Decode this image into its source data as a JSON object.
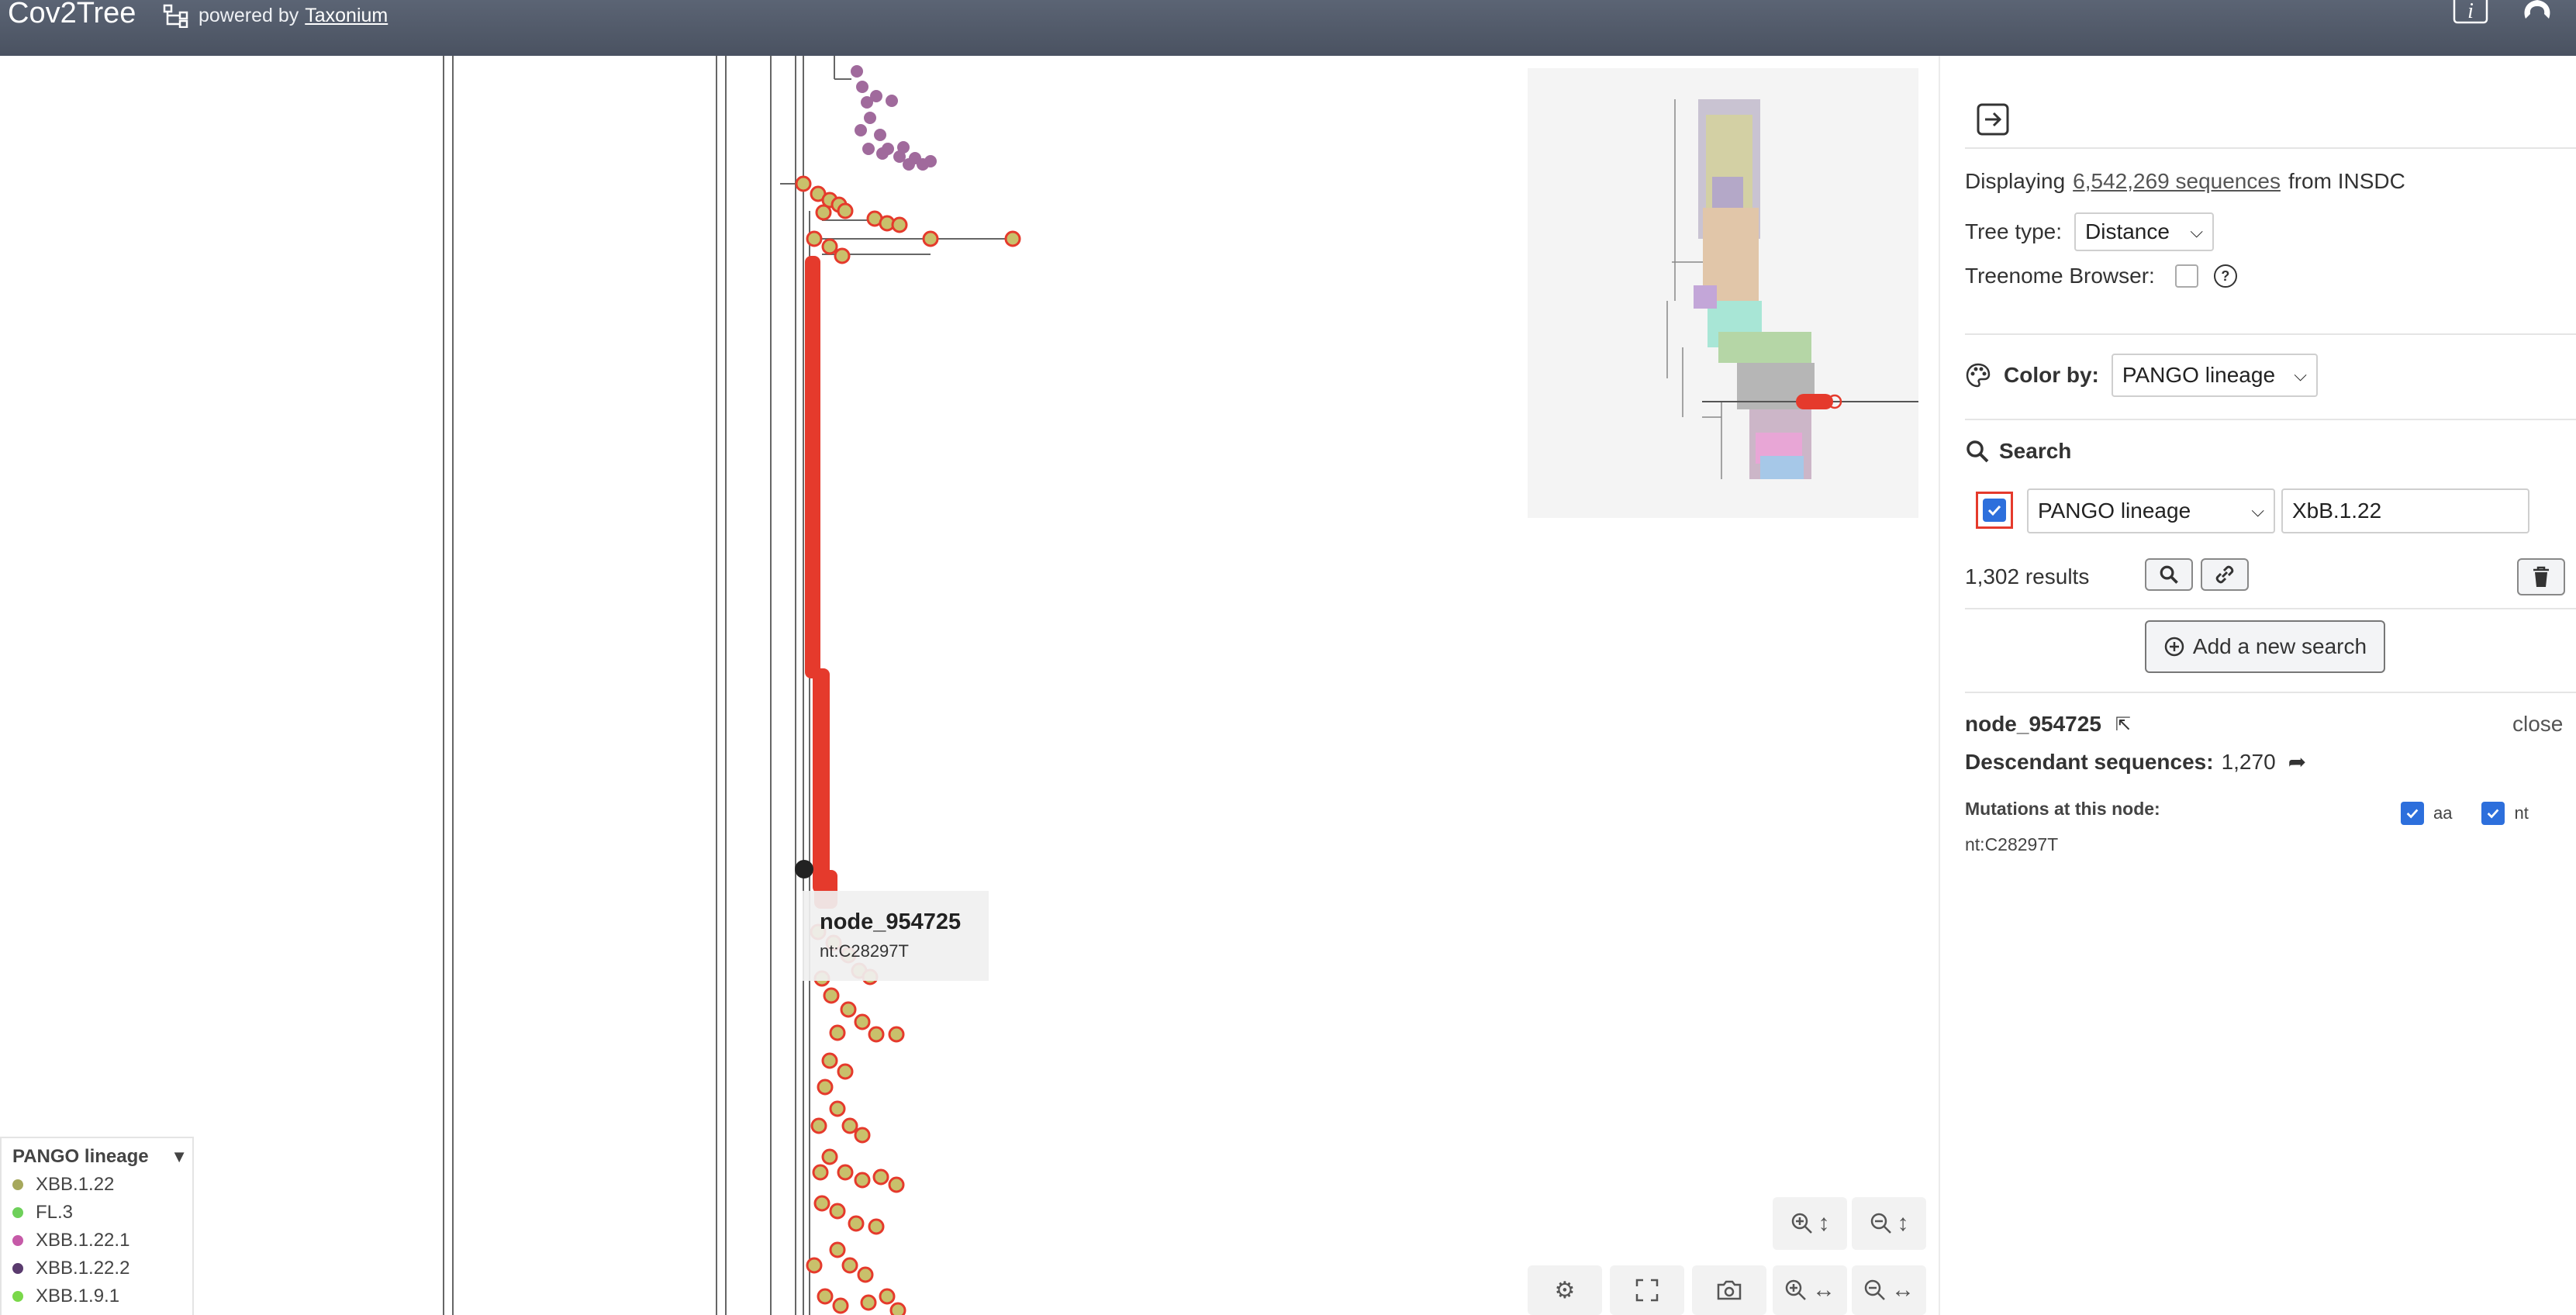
{
  "header": {
    "title": "Cov2Tree",
    "powered_by": "powered by",
    "powered_link": "Taxonium"
  },
  "sidebar": {
    "displaying_prefix": "Displaying",
    "sequence_count": "6,542,269 sequences",
    "displaying_suffix": "from INSDC",
    "tree_type_label": "Tree type:",
    "tree_type_value": "Distance",
    "treenome_label": "Treenome Browser:",
    "treenome_checked": false,
    "color_by_label": "Color by:",
    "color_by_value": "PANGO lineage",
    "search_label": "Search",
    "search": {
      "enabled": true,
      "field": "PANGO lineage",
      "value": "XbB.1.22",
      "results": "1,302 results"
    },
    "add_search_label": "Add a new search",
    "node": {
      "name": "node_954725",
      "close_label": "close",
      "descendant_label": "Descendant sequences:",
      "descendant_count": "1,270",
      "mutations_label": "Mutations at this node:",
      "aa_label": "aa",
      "nt_label": "nt",
      "mutation": "nt:C28297T"
    }
  },
  "legend": {
    "title": "PANGO lineage",
    "items": [
      {
        "label": "XBB.1.22",
        "color": "#a6a85c"
      },
      {
        "label": "FL.3",
        "color": "#6ed05a"
      },
      {
        "label": "XBB.1.22.1",
        "color": "#c65aa8"
      },
      {
        "label": "XBB.1.22.2",
        "color": "#5a3b6e"
      },
      {
        "label": "XBB.1.9.1",
        "color": "#7ad84a"
      }
    ]
  },
  "tooltip": {
    "name": "node_954725",
    "mutation": "nt:C28297T"
  },
  "colors": {
    "header": "#4f5767",
    "highlight": "#e53a2c",
    "accent": "#2d6fdc",
    "branch": "#555555",
    "cluster_purple": "#a06a9c"
  },
  "icons": {
    "info": "info-icon",
    "github": "github-icon",
    "tree": "tree-structure-icon",
    "collapse": "arrow-right-box-icon",
    "palette": "palette-icon",
    "search": "magnifier-icon",
    "link": "link-icon",
    "trash": "trash-icon",
    "add": "plus-circle-icon",
    "navigate": "arrow-up-left-icon",
    "share": "share-arrow-icon",
    "settings": "gear-icon",
    "fullscreen": "fullscreen-icon",
    "camera": "camera-icon",
    "zoom_in": "zoom-in-icon",
    "zoom_out": "zoom-out-icon"
  }
}
